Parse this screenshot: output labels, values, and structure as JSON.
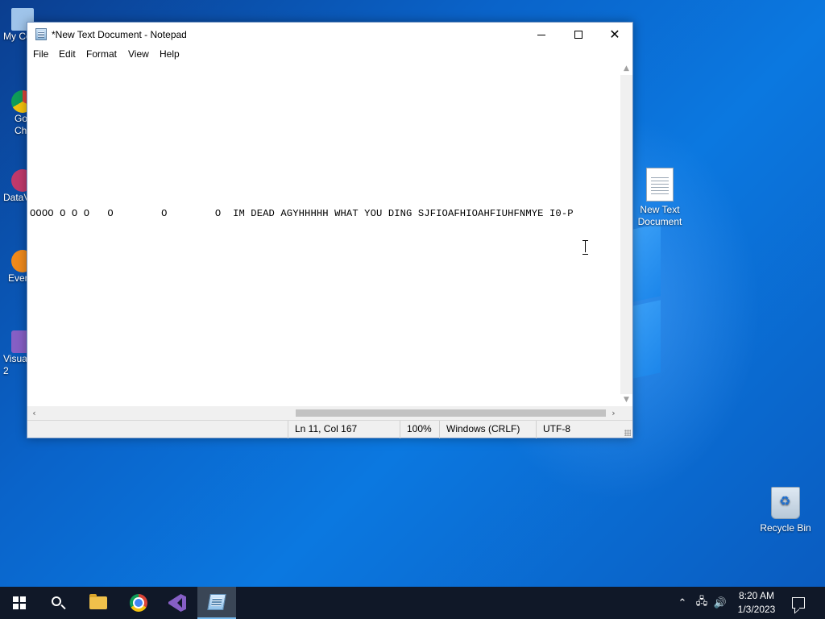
{
  "desktop": {
    "icons": [
      {
        "label": "My Co",
        "name": "my-computer"
      },
      {
        "label": "Go\nCh",
        "name": "google-chrome"
      },
      {
        "label": "DataV",
        "name": "datav"
      },
      {
        "label": "Ever",
        "name": "everything"
      },
      {
        "label": "Visua\n2",
        "name": "visual-studio"
      }
    ],
    "new_doc_label_1": "New Text",
    "new_doc_label_2": "Document",
    "recycle_label": "Recycle Bin"
  },
  "window": {
    "title": "*New Text Document - Notepad",
    "menu": [
      "File",
      "Edit",
      "Format",
      "View",
      "Help"
    ],
    "editor_text": "OOOO O O O   O        O        O  IM DEAD AGYHHHHH WHAT YOU DING SJFIOAFHIOAHFIUHFNMYE I0-P",
    "status": {
      "position": "Ln 11, Col 167",
      "zoom": "100%",
      "line_ending": "Windows (CRLF)",
      "encoding": "UTF-8"
    }
  },
  "taskbar": {
    "time": "8:20 AM",
    "date": "1/3/2023"
  },
  "colors": {
    "wallpaper": "#0a63c9",
    "taskbar": "#101828",
    "active_accent": "#76b9ed"
  }
}
